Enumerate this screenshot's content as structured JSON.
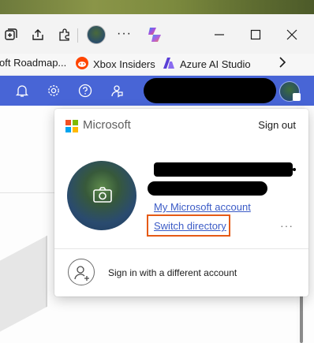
{
  "browser": {
    "icons": [
      "collections-icon",
      "share-icon",
      "extensions-icon",
      "profile-icon",
      "more-icon",
      "copilot-icon",
      "minimize-icon",
      "maximize-icon",
      "close-icon"
    ],
    "more_glyph": "···",
    "bookmarks": [
      {
        "label": "oft Roadmap...",
        "icon": "none"
      },
      {
        "label": "Xbox Insiders",
        "icon": "reddit-icon"
      },
      {
        "label": "Azure AI Studio",
        "icon": "azure-ai-icon"
      }
    ]
  },
  "header": {
    "icons": [
      "bell-icon",
      "gear-icon",
      "help-icon",
      "feedback-icon"
    ],
    "accent": "#4865d6"
  },
  "flyout": {
    "brand": "Microsoft",
    "sign_out": "Sign out",
    "my_account_link": "My Microsoft account",
    "switch_directory_link": "Switch directory",
    "more_glyph": "···",
    "different_account": "Sign in with a different account",
    "highlight_color": "#e55a16"
  }
}
